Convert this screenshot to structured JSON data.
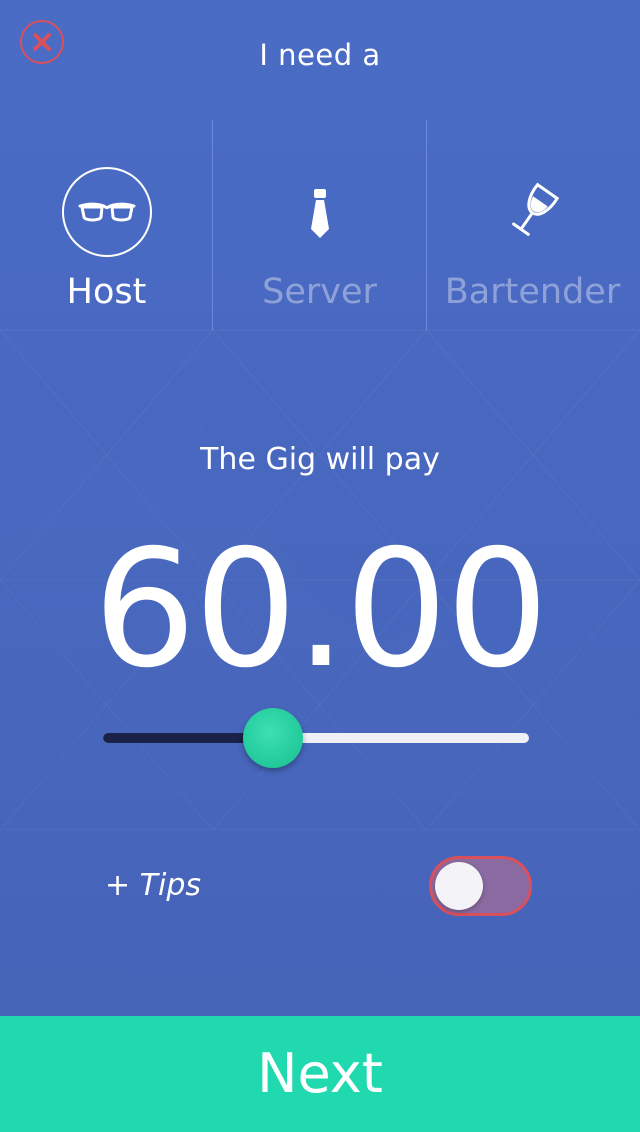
{
  "header": {
    "title": "I need a",
    "close_icon": "close-icon"
  },
  "roles": [
    {
      "label": "Host",
      "icon": "glasses-icon",
      "selected": true
    },
    {
      "label": "Server",
      "icon": "necktie-icon",
      "selected": false
    },
    {
      "label": "Bartender",
      "icon": "wine-glass-icon",
      "selected": false
    }
  ],
  "pay": {
    "label": "The Gig will pay",
    "amount": "60.00"
  },
  "slider": {
    "fraction": 0.4
  },
  "tips": {
    "label": "+ Tips",
    "enabled": false
  },
  "next_label": "Next",
  "colors": {
    "background": "#4a6cc5",
    "accent": "#20d9ae",
    "close": "#d9505d",
    "toggle_track": "#8a6aa0",
    "slider_fill": "#1a2247"
  }
}
